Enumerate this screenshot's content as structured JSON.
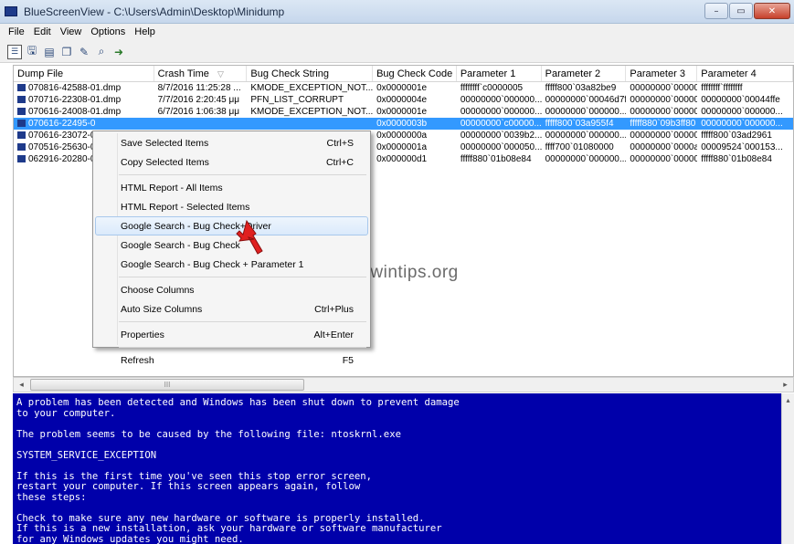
{
  "window": {
    "title": "BlueScreenView  -  C:\\Users\\Admin\\Desktop\\Minidump",
    "minimize": "–",
    "maximize": "▭",
    "close": "✕"
  },
  "menubar": [
    "File",
    "Edit",
    "View",
    "Options",
    "Help"
  ],
  "toolbar": {
    "icons": [
      "properties-icon",
      "save-icon",
      "html-report-icon",
      "copy-icon",
      "options-icon",
      "find-icon",
      "exit-icon"
    ]
  },
  "list": {
    "columns": [
      "Dump File",
      "Crash Time",
      "Bug Check String",
      "Bug Check Code",
      "Parameter 1",
      "Parameter 2",
      "Parameter 3",
      "Parameter 4"
    ],
    "sort_indicator": "▽",
    "rows": [
      [
        "070816-42588-01.dmp",
        "8/7/2016 11:25:28 ...",
        "KMODE_EXCEPTION_NOT...",
        "0x0000001e",
        "ffffffff`c0000005",
        "fffff800`03a82be9",
        "00000000`000000...",
        "ffffffff`ffffffff"
      ],
      [
        "070716-22308-01.dmp",
        "7/7/2016 2:20:45 μμ",
        "PFN_LIST_CORRUPT",
        "0x0000004e",
        "00000000`000000...",
        "00000000`00046d7f",
        "00000000`000000...",
        "00000000`00044ffe"
      ],
      [
        "070616-24008-01.dmp",
        "6/7/2016 1:06:38 μμ",
        "KMODE_EXCEPTION_NOT...",
        "0x0000001e",
        "00000000`000000...",
        "00000000`000000...",
        "00000000`000000...",
        "00000000`000000..."
      ],
      [
        "070616-22495-0",
        "",
        "",
        "0x0000003b",
        "00000000`c00000...",
        "fffff800`03a955f4",
        "fffff880`09b3ff80",
        "00000000`000000..."
      ],
      [
        "070616-23072-0",
        "",
        "",
        "0x0000000a",
        "00000000`0039b2...",
        "00000000`000000...",
        "00000000`000000...",
        "fffff800`03ad2961"
      ],
      [
        "070516-25630-0",
        "",
        "",
        "0x0000001a",
        "00000000`000050...",
        "ffff700`01080000",
        "00000000`0000ad...",
        "00009524`000153..."
      ],
      [
        "062916-20280-0",
        "",
        "",
        "0x000000d1",
        "fffff880`01b08e84",
        "00000000`000000...",
        "00000000`000000...",
        "fffff880`01b08e84"
      ]
    ],
    "selected_row": 3
  },
  "hscroll": {
    "left": "◂",
    "right": "▸",
    "thumb": "III"
  },
  "context_menu": {
    "items": [
      {
        "label": "Save Selected Items",
        "shortcut": "Ctrl+S"
      },
      {
        "label": "Copy Selected Items",
        "shortcut": "Ctrl+C"
      },
      {
        "sep": true
      },
      {
        "label": "HTML Report - All Items",
        "shortcut": ""
      },
      {
        "label": "HTML Report - Selected Items",
        "shortcut": ""
      },
      {
        "label": "Google Search - Bug Check+Driver",
        "shortcut": "",
        "highlighted": true
      },
      {
        "label": "Google Search - Bug Check",
        "shortcut": ""
      },
      {
        "label": "Google Search - Bug Check + Parameter 1",
        "shortcut": ""
      },
      {
        "sep": true
      },
      {
        "label": "Choose Columns",
        "shortcut": ""
      },
      {
        "label": "Auto Size Columns",
        "shortcut": "Ctrl+Plus"
      },
      {
        "sep": true
      },
      {
        "label": "Properties",
        "shortcut": "Alt+Enter"
      },
      {
        "sep": true
      },
      {
        "label": "Refresh",
        "shortcut": "F5"
      }
    ]
  },
  "watermark": "www.wintips.org",
  "bsod": {
    "paragraphs": [
      "A problem has been detected and Windows has been shut down to prevent damage\nto your computer.",
      "The problem seems to be caused by the following file: ntoskrnl.exe",
      "SYSTEM_SERVICE_EXCEPTION",
      "If this is the first time you've seen this stop error screen,\nrestart your computer. If this screen appears again, follow\nthese steps:",
      "Check to make sure any new hardware or software is properly installed.\nIf this is a new installation, ask your hardware or software manufacturer\nfor any Windows updates you might need."
    ],
    "scroll_up": "▴"
  },
  "colors": {
    "selection": "#3399ff",
    "bsod_background": "#0000aa",
    "bsod_text": "#ffffff",
    "cursor_arrow": "#e02020"
  }
}
